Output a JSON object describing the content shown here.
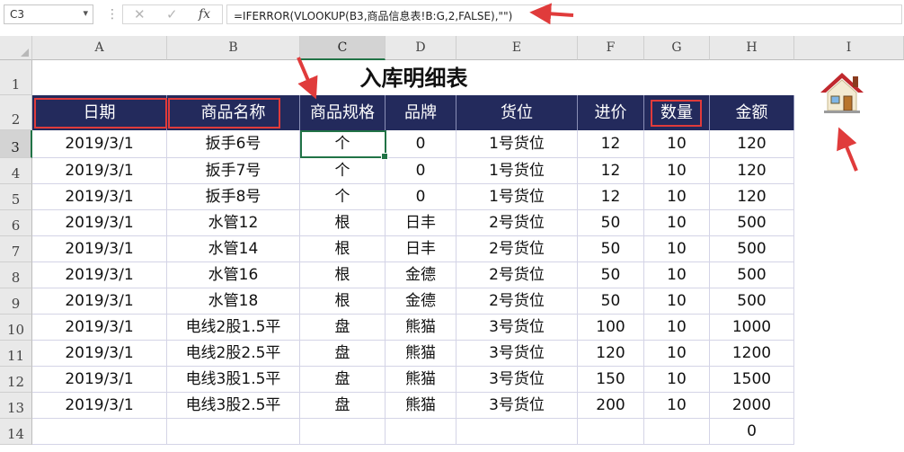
{
  "formula_bar": {
    "name_box": "C3",
    "formula": "=IFERROR(VLOOKUP(B3,商品信息表!B:G,2,FALSE),\"\")"
  },
  "columns": [
    "A",
    "B",
    "C",
    "D",
    "E",
    "F",
    "G",
    "H",
    "I"
  ],
  "rows": [
    "1",
    "2",
    "3",
    "4",
    "5",
    "6",
    "7",
    "8",
    "9",
    "10",
    "11",
    "12",
    "13",
    "14"
  ],
  "sheet": {
    "title": "入库明细表",
    "headers": [
      "日期",
      "商品名称",
      "商品规格",
      "品牌",
      "货位",
      "进价",
      "数量",
      "金额"
    ],
    "data": [
      [
        "2019/3/1",
        "扳手6号",
        "个",
        "0",
        "1号货位",
        "12",
        "10",
        "120"
      ],
      [
        "2019/3/1",
        "扳手7号",
        "个",
        "0",
        "1号货位",
        "12",
        "10",
        "120"
      ],
      [
        "2019/3/1",
        "扳手8号",
        "个",
        "0",
        "1号货位",
        "12",
        "10",
        "120"
      ],
      [
        "2019/3/1",
        "水管12",
        "根",
        "日丰",
        "2号货位",
        "50",
        "10",
        "500"
      ],
      [
        "2019/3/1",
        "水管14",
        "根",
        "日丰",
        "2号货位",
        "50",
        "10",
        "500"
      ],
      [
        "2019/3/1",
        "水管16",
        "根",
        "金德",
        "2号货位",
        "50",
        "10",
        "500"
      ],
      [
        "2019/3/1",
        "水管18",
        "根",
        "金德",
        "2号货位",
        "50",
        "10",
        "500"
      ],
      [
        "2019/3/1",
        "电线2股1.5平",
        "盘",
        "熊猫",
        "3号货位",
        "100",
        "10",
        "1000"
      ],
      [
        "2019/3/1",
        "电线2股2.5平",
        "盘",
        "熊猫",
        "3号货位",
        "120",
        "10",
        "1200"
      ],
      [
        "2019/3/1",
        "电线3股1.5平",
        "盘",
        "熊猫",
        "3号货位",
        "150",
        "10",
        "1500"
      ],
      [
        "2019/3/1",
        "电线3股2.5平",
        "盘",
        "熊猫",
        "3号货位",
        "200",
        "10",
        "2000"
      ],
      [
        "",
        "",
        "",
        "",
        "",
        "",
        "",
        "0"
      ]
    ]
  },
  "annotation_color": "#e03b3b",
  "header_bg": "#232a5c",
  "selection_color": "#217346",
  "icons": [
    "home-icon"
  ]
}
